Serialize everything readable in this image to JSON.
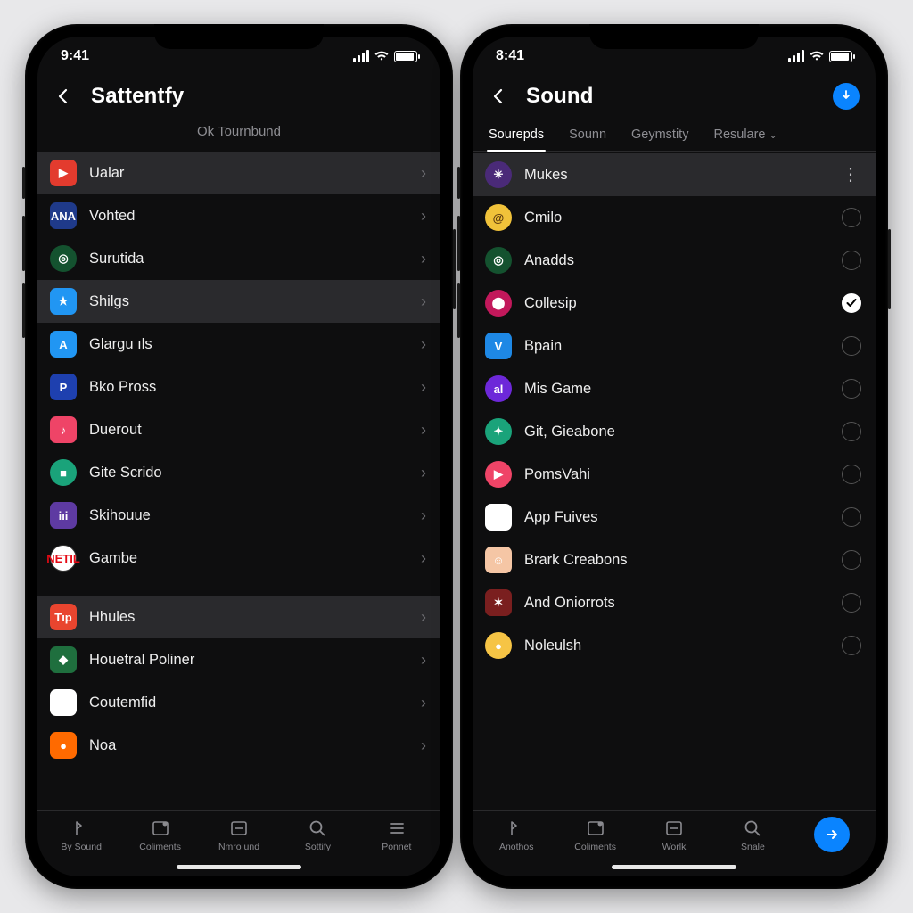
{
  "left": {
    "status_time": "9:41",
    "title": "Sattentfy",
    "subhead": "Ok Tournbund",
    "items": [
      {
        "label": "Ualar",
        "sel": true,
        "glyph": "▶",
        "round": false
      },
      {
        "label": "Vohted",
        "sel": false,
        "glyph": "ANA",
        "round": false,
        "mini": true
      },
      {
        "label": "Surutida",
        "sel": false,
        "glyph": "◎",
        "round": true
      },
      {
        "label": "Shilgs",
        "sel": true,
        "glyph": "★",
        "round": false
      },
      {
        "label": "Glargu ıls",
        "sel": false,
        "glyph": "A",
        "round": false
      },
      {
        "label": "Bko Pross",
        "sel": false,
        "glyph": "P",
        "round": false
      },
      {
        "label": "Duerout",
        "sel": false,
        "glyph": "♪",
        "round": false
      },
      {
        "label": "Gite Scrido",
        "sel": false,
        "glyph": "■",
        "round": true
      },
      {
        "label": "Skihouue",
        "sel": false,
        "glyph": "iıi",
        "round": false,
        "mini": true
      },
      {
        "label": "Gambe",
        "sel": false,
        "glyph": "NETIL",
        "round": true,
        "mini": true
      }
    ],
    "items2": [
      {
        "label": "Hhules",
        "sel": true,
        "glyph": "Tıp",
        "round": false,
        "mini": true
      },
      {
        "label": "Houetral Poliner",
        "sel": false,
        "glyph": "◆",
        "round": false
      },
      {
        "label": "Coutemfid",
        "sel": false,
        "glyph": "◧",
        "round": false
      },
      {
        "label": "Noa",
        "sel": false,
        "glyph": "●",
        "round": false
      }
    ],
    "nav": [
      {
        "label": "By Sound"
      },
      {
        "label": "Coliments"
      },
      {
        "label": "Nmro und"
      },
      {
        "label": "Sottify"
      },
      {
        "label": "Ponnet"
      }
    ]
  },
  "right": {
    "status_time": "8:41",
    "title": "Sound",
    "tabs": [
      {
        "label": "Sourepds",
        "active": true
      },
      {
        "label": "Sounn",
        "active": false
      },
      {
        "label": "Geymstity",
        "active": false
      },
      {
        "label": "Resulare",
        "active": false,
        "drop": true
      }
    ],
    "items": [
      {
        "label": "Mukes",
        "sel": true,
        "mode": "more",
        "glyph": "✳",
        "round": true
      },
      {
        "label": "Cmilo",
        "mode": "radio",
        "checked": false,
        "glyph": "@",
        "round": true
      },
      {
        "label": "Anadds",
        "mode": "radio",
        "checked": false,
        "glyph": "◎",
        "round": true
      },
      {
        "label": "Collesip",
        "mode": "radio",
        "checked": true,
        "glyph": "⬤",
        "round": true
      },
      {
        "label": "Bpain",
        "mode": "radio",
        "checked": false,
        "glyph": "V",
        "round": false
      },
      {
        "label": "Mis Game",
        "mode": "radio",
        "checked": false,
        "glyph": "al",
        "round": true,
        "mini": true
      },
      {
        "label": "Git, Gieabone",
        "mode": "radio",
        "checked": false,
        "glyph": "✦",
        "round": true
      },
      {
        "label": "PomsVahi",
        "mode": "radio",
        "checked": false,
        "glyph": "▶",
        "round": true
      },
      {
        "label": "App Fuives",
        "mode": "radio",
        "checked": false,
        "glyph": "▶",
        "round": false
      },
      {
        "label": "Brark Creabons",
        "mode": "radio",
        "checked": false,
        "glyph": "☺",
        "round": false
      },
      {
        "label": "And Oniorrots",
        "mode": "radio",
        "checked": false,
        "glyph": "✶",
        "round": false
      },
      {
        "label": "Noleulsh",
        "mode": "radio",
        "checked": false,
        "glyph": "●",
        "round": true
      }
    ],
    "nav": [
      {
        "label": "Anothos"
      },
      {
        "label": "Coliments"
      },
      {
        "label": "Worlk"
      },
      {
        "label": "Snale"
      }
    ]
  }
}
